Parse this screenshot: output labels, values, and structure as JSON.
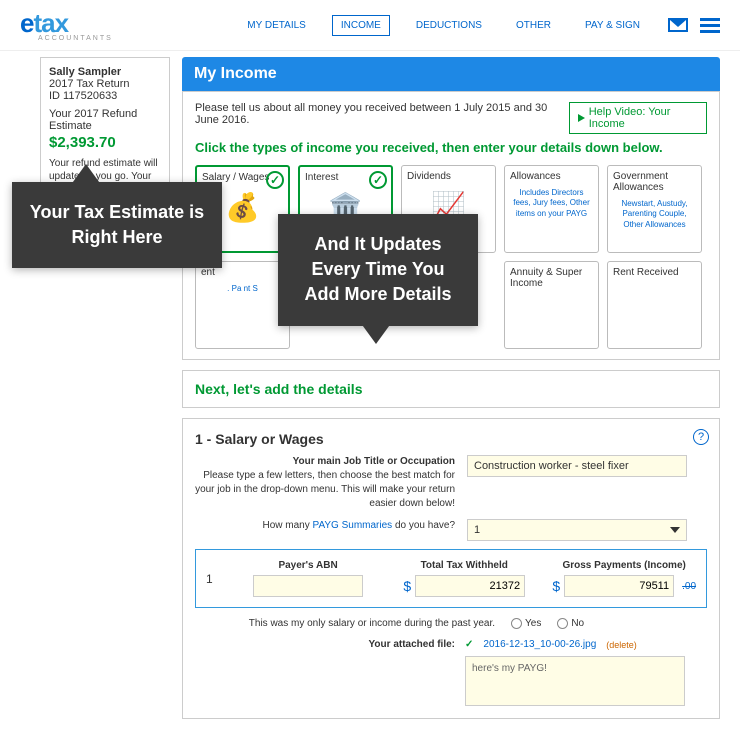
{
  "logo": {
    "part1": "e",
    "part2": "tax",
    "sub": "ACCOUNTANTS"
  },
  "nav": {
    "my_details": "MY DETAILS",
    "income": "INCOME",
    "deductions": "DEDUCTIONS",
    "other": "OTHER",
    "pay_sign": "PAY & SIGN"
  },
  "sidebar": {
    "name": "Sally Sampler",
    "return": "2017 Tax Return",
    "id": "ID 117520633",
    "refund_label": "Your 2017 Refund Estimate",
    "refund_value": "$2,393.70",
    "note": "Your refund estimate will update as you go. Your return gets more accurate as you add details about your income."
  },
  "title": "My Income",
  "intro": "Please tell us about all money you received between 1 July 2015 and 30 June 2016.",
  "help_video": "Help Video: Your Income",
  "instruction": "Click the types of income you received, then enter your details down below.",
  "tiles": {
    "salary": "Salary / Wages",
    "interest": "Interest",
    "dividends": "Dividends",
    "allowances": "Allowances",
    "allowances_sub": "Includes Directors fees, Jury fees, Other items on your PAYG",
    "gov": "Government Allowances",
    "gov_sub": "Newstart, Austudy, Parenting Couple, Other Allowances",
    "row2_a": "ent",
    "row2_a_sub": ". Pa\nnt S",
    "annuity": "Annuity & Super Income",
    "rent": "Rent Received"
  },
  "next": "Next, let's add the details",
  "section1_title": "1 - Salary or Wages",
  "job_label_bold": "Your main Job Title or Occupation",
  "job_help": "Please type a few letters, then choose the best match for your job in the drop-down menu. This will make your return easier down below!",
  "job_value": "Construction worker - steel fixer",
  "payg_q_pre": "How many ",
  "payg_link": "PAYG Summaries",
  "payg_q_post": " do you have?",
  "payg_count": "1",
  "payg_headers": {
    "abn": "Payer's ABN",
    "tax": "Total Tax Withheld",
    "gross": "Gross Payments (Income)"
  },
  "payg_row": {
    "num": "1",
    "abn": "",
    "tax": "21372",
    "gross": "79511",
    "extra": ".00"
  },
  "only_salary": "This was my only salary or income during the past year.",
  "yes": "Yes",
  "no": "No",
  "attached_label": "Your attached file:",
  "attached_name": "2016-12-13_10-00-26.jpg",
  "attached_del": "(delete)",
  "comment": "here's my PAYG!",
  "callout1": "Your Tax Estimate is Right Here",
  "callout2": "And It Updates Every Time You Add More Details"
}
